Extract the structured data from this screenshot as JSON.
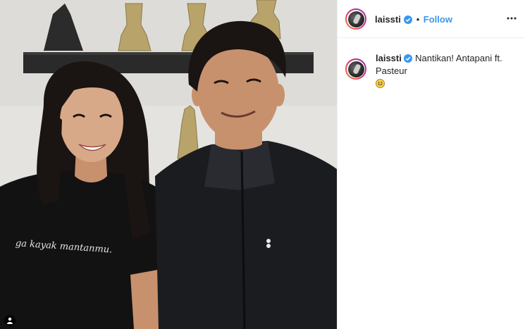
{
  "post": {
    "username": "laissti",
    "follow_label": "Follow",
    "separator": "•",
    "caption": {
      "username": "laissti",
      "text": "Nantikan! Antapani ft. Pasteur",
      "emoji": "grinning-face-emoji"
    },
    "photo_shirt_text": "ga kayak mantanmu."
  },
  "icons": {
    "verified": "verified-badge-icon",
    "more": "more-options-icon",
    "tag": "user-tag-icon"
  },
  "colors": {
    "accent": "#3897f0",
    "text": "#262626",
    "border": "#efefef"
  }
}
